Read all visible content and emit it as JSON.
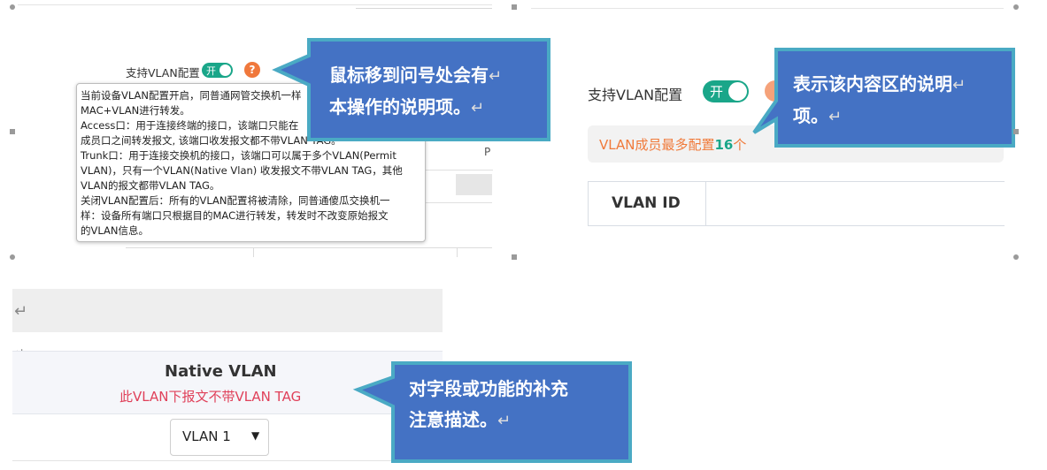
{
  "left_panel": {
    "label": "支持VLAN配置",
    "toggle_text": "开",
    "help_mark": "?",
    "tooltip_lines": [
      "当前设备VLAN配置开启，同普通网管交换机一样",
      "MAC+VLAN进行转发。",
      "Access口：用于连接终端的接口，该端口只能在",
      "成员口之间转发报文, 该端口收发报文都不带VLAN TAG。",
      "Trunk口：用于连接交换机的接口，该端口可以属于多个VLAN(Permit",
      "VLAN)，只有一个VLAN(Native Vlan) 收发报文不带VLAN TAG，其他",
      "VLAN的报文都带VLAN TAG。",
      "关闭VLAN配置后：所有的VLAN配置将被清除，同普通傻瓜交换机一",
      "样：设备所有端口只根据目的MAC进行转发，转发时不改变原始报文",
      "的VLAN信息。"
    ],
    "bg_fragment": "P"
  },
  "callout1": {
    "line1": "鼠标移到问号处会有",
    "line2": "本操作的说明项。"
  },
  "right_panel": {
    "label": "支持VLAN配置",
    "toggle_text": "开",
    "notice_text": "VLAN成员最多配置",
    "notice_num": "16",
    "notice_tail": "个",
    "header": "VLAN ID"
  },
  "callout2": {
    "line1": "表示该内容区的说明",
    "line2": "项。"
  },
  "bottom_panel": {
    "title": "Native VLAN",
    "subtitle": "此VLAN下报文不带VLAN TAG",
    "select_value": "VLAN 1"
  },
  "callout3": {
    "line1": "对字段或功能的补充",
    "line2": "注意描述。"
  },
  "return_mark": "↵",
  "colors": {
    "callout_fill": "#4472c4",
    "callout_border": "#4aaac4",
    "accent": "#1aa689",
    "orange": "#f07a3a",
    "red": "#e0415a"
  }
}
